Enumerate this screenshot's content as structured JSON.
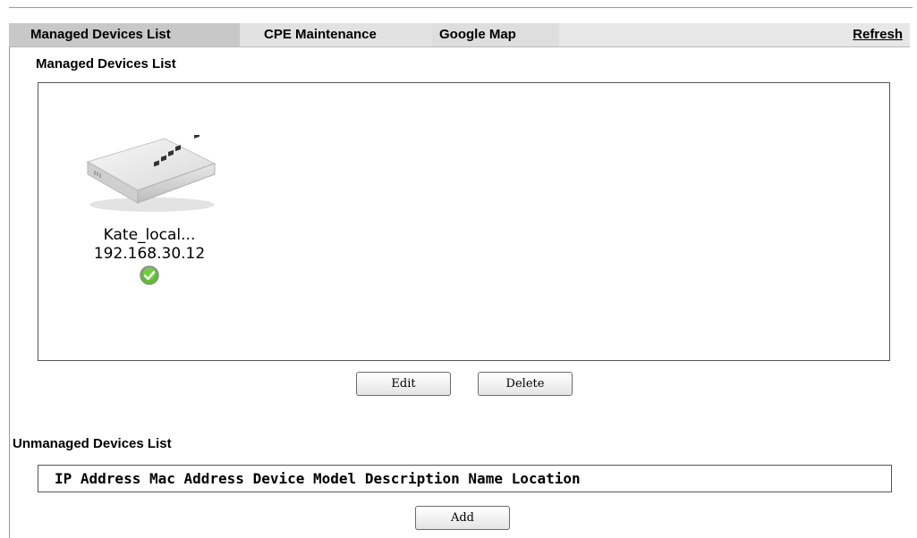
{
  "tabs": [
    {
      "label": "Managed Devices List",
      "active": true
    },
    {
      "label": "CPE Maintenance",
      "active": false
    },
    {
      "label": "Google Map",
      "active": false
    }
  ],
  "refresh_label": "Refresh",
  "managed": {
    "title": "Managed Devices List",
    "devices": [
      {
        "name": "Kate_local...",
        "ip": "192.168.30.12",
        "status_icon": "online-check-icon"
      }
    ]
  },
  "buttons": {
    "edit": "Edit",
    "delete": "Delete",
    "add": "Add"
  },
  "unmanaged": {
    "title": "Unmanaged Devices List",
    "columns": [
      "IP Address",
      "Mac Address",
      "Device Model",
      "Description",
      "Name",
      "Location"
    ]
  },
  "colors": {
    "status_green": "#4caf2a",
    "tab_active": "#c8c8c8",
    "tab_bar": "#e7e7e7"
  }
}
